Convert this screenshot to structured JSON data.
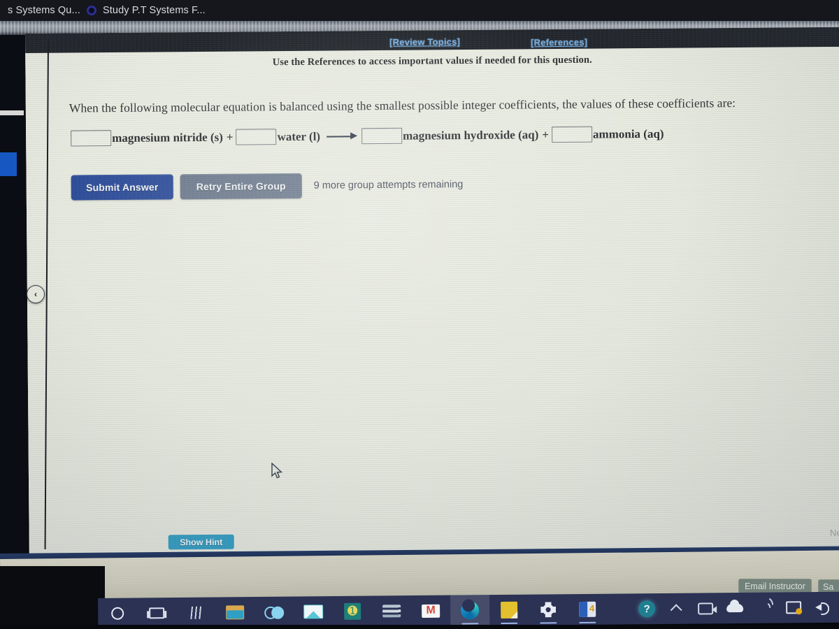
{
  "browser": {
    "tabs": [
      {
        "title": "s Systems Qu...",
        "favicon": "blank-favicon",
        "active": false
      },
      {
        "title": "Study P.T Systems F...",
        "favicon": "circle-favicon",
        "active": true
      }
    ]
  },
  "header": {
    "review_topics_link": "[Review Topics]",
    "references_link": "[References]",
    "instruction": "Use the References to access important values if needed for this question."
  },
  "question": {
    "prompt": "When the following molecular equation is balanced using the smallest possible integer coefficients, the values of these coefficients are:",
    "equation": {
      "reactants": [
        {
          "coefficient": "",
          "placeholder": "",
          "species": "magnesium nitride (s)"
        },
        {
          "coefficient": "",
          "placeholder": "",
          "species": "water (l)"
        }
      ],
      "products": [
        {
          "coefficient": "",
          "placeholder": "",
          "species": "magnesium hydroxide (aq)"
        },
        {
          "coefficient": "",
          "placeholder": "",
          "species": "ammonia (aq)"
        }
      ],
      "plus_symbol": "+",
      "arrow_symbol": "right-arrow"
    }
  },
  "actions": {
    "submit_label": "Submit Answer",
    "retry_label": "Retry Entire Group",
    "attempts_text": "9 more group attempts remaining",
    "hint_label": "Show Hint",
    "next_label": "Ne",
    "collapse_label": "‹"
  },
  "footer": {
    "email_instructor_label": "Email Instructor",
    "save_label": "Sa"
  },
  "taskbar": {
    "items": [
      {
        "name": "cortana-icon",
        "label": "Cortana"
      },
      {
        "name": "task-view-icon",
        "label": "Task View"
      },
      {
        "name": "pipes-icon",
        "label": "Pipes"
      },
      {
        "name": "file-explorer-icon",
        "label": "File Explorer"
      },
      {
        "name": "infinity-icon",
        "label": "Infinity"
      },
      {
        "name": "mail-icon",
        "label": "Mail"
      },
      {
        "name": "green-app-icon",
        "label": "Green App"
      },
      {
        "name": "stack-icon",
        "label": "Stack"
      },
      {
        "name": "gmail-icon",
        "label": "Gmail"
      },
      {
        "name": "edge-icon",
        "label": "Microsoft Edge"
      },
      {
        "name": "sticky-notes-icon",
        "label": "Sticky Notes"
      },
      {
        "name": "settings-gear-icon",
        "label": "Settings"
      },
      {
        "name": "office-icon",
        "label": "Office"
      }
    ],
    "tray": [
      {
        "name": "help-icon",
        "label": "?"
      },
      {
        "name": "chevron-up-icon",
        "label": "Show hidden icons"
      },
      {
        "name": "camera-icon",
        "label": "Camera"
      },
      {
        "name": "onedrive-cloud-icon",
        "label": "OneDrive"
      },
      {
        "name": "wifi-icon",
        "label": "Network"
      },
      {
        "name": "battery-icon",
        "label": "Battery"
      },
      {
        "name": "volume-icon",
        "label": "Volume"
      }
    ]
  },
  "colors": {
    "submit_blue": "#17398f",
    "retry_gray": "#5d6b80",
    "hint_teal": "#2295bf",
    "link_blue": "#6fa8dc",
    "page_bg": "#e9eadf",
    "taskbar_bg": "#2b3254"
  }
}
